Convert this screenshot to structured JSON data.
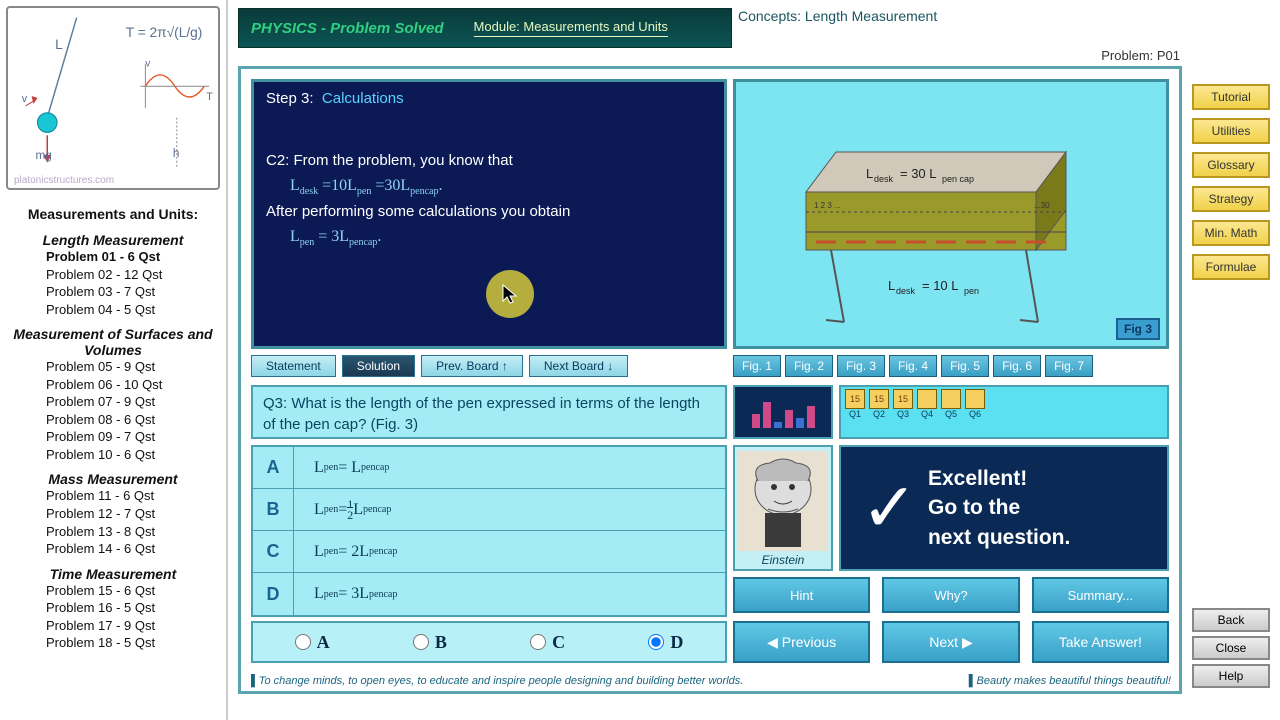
{
  "header": {
    "app_title": "PHYSICS - Problem Solved",
    "module": "Module: Measurements and Units",
    "concepts": "Concepts: Length Measurement",
    "problem": "Problem: P01"
  },
  "diagram": {
    "formula": "T = 2π√(L/g)",
    "watermark": "platonicstructures.com",
    "labels": {
      "L": "L",
      "mg": "mg",
      "v": "v",
      "T": "T",
      "h": "h"
    }
  },
  "topics": {
    "title": "Measurements and Units:",
    "sections": [
      {
        "name": "Length Measurement",
        "items": [
          {
            "label": "Problem 01   -  6 Qst",
            "selected": true
          },
          {
            "label": "Problem 02   - 12 Qst"
          },
          {
            "label": "Problem 03   -  7 Qst"
          },
          {
            "label": "Problem 04   -  5 Qst"
          }
        ]
      },
      {
        "name": "Measurement of Surfaces and Volumes",
        "items": [
          {
            "label": "Problem 05   -  9 Qst"
          },
          {
            "label": "Problem 06   - 10 Qst"
          },
          {
            "label": "Problem 07   -  9 Qst"
          },
          {
            "label": "Problem 08   -  6 Qst"
          },
          {
            "label": "Problem 09   -  7 Qst"
          },
          {
            "label": "Problem 10   -  6 Qst"
          }
        ]
      },
      {
        "name": "Mass Measurement",
        "items": [
          {
            "label": "Problem 11   -  6 Qst"
          },
          {
            "label": "Problem 12   -  7 Qst"
          },
          {
            "label": "Problem 13   -  8 Qst"
          },
          {
            "label": "Problem 14   -  6 Qst"
          }
        ]
      },
      {
        "name": "Time Measurement",
        "items": [
          {
            "label": "Problem 15   -  6 Qst"
          },
          {
            "label": "Problem 16   -  5 Qst"
          },
          {
            "label": "Problem 17   -  9 Qst"
          },
          {
            "label": "Problem 18   -  5 Qst"
          }
        ]
      }
    ]
  },
  "calc": {
    "step_prefix": "Step 3:",
    "step_name": "Calculations",
    "c2_label": "C2:",
    "line1": "From the problem, you know that",
    "eq1": "L_desk = 10L_pen = 30L_pencap",
    "line2": "After performing some calculations you obtain",
    "eq2": "L_pen = 3L_pencap"
  },
  "figure": {
    "label_top": "L_desk = 30 L_pen cap",
    "label_bottom": "L_desk = 10 L_pen",
    "badge": "Fig 3"
  },
  "tabs": {
    "statement": "Statement",
    "solution": "Solution",
    "prev_board": "Prev. Board ↑",
    "next_board": "Next Board ↓",
    "figs": [
      "Fig. 1",
      "Fig. 2",
      "Fig. 3",
      "Fig. 4",
      "Fig. 5",
      "Fig. 6",
      "Fig. 7"
    ]
  },
  "question": {
    "qnum": "Q3:",
    "text": "What is the length of the pen expressed in terms of the length of the pen cap? (Fig. 3)"
  },
  "scores": [
    "Q1",
    "Q2",
    "Q3",
    "Q4",
    "Q5",
    "Q6"
  ],
  "score_values": [
    "15",
    "15",
    "15",
    "",
    "",
    ""
  ],
  "answers": {
    "A": "L_pen = L_pencap",
    "B": "L_pen = ½ L_pencap",
    "C": "L_pen = 2L_pencap",
    "D": "L_pen = 3L_pencap"
  },
  "einstein": "Einstein",
  "feedback": {
    "line1": "Excellent!",
    "line2": "Go to the",
    "line3": "next question."
  },
  "hints": {
    "hint": "Hint",
    "why": "Why?",
    "summary": "Summary..."
  },
  "radios": [
    "A",
    "B",
    "C",
    "D"
  ],
  "selected_radio": "D",
  "nav": {
    "prev": "◀ Previous",
    "next": "Next  ▶",
    "take": "Take Answer!"
  },
  "footer": {
    "left": "To change minds, to open eyes, to educate and inspire people designing and building better worlds.",
    "right": "Beauty makes beautiful things beautiful!"
  },
  "right_buttons": [
    "Tutorial",
    "Utilities",
    "Glossary",
    "Strategy",
    "Min. Math",
    "Formulae"
  ],
  "bottom_buttons": [
    "Back",
    "Close",
    "Help"
  ]
}
